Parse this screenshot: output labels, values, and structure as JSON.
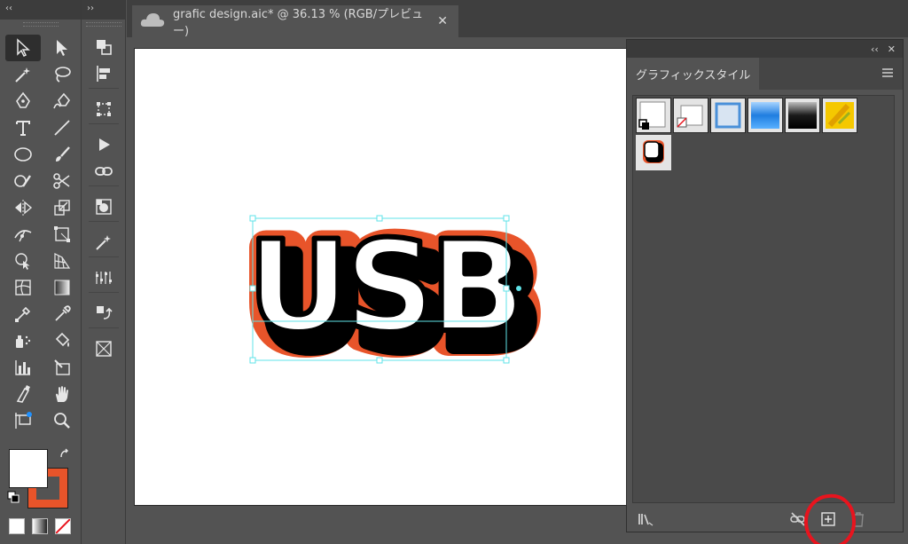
{
  "app": {
    "collapse_left": "‹‹",
    "collapse_dock": "››"
  },
  "document_tab": {
    "title": "grafic design.aic* @ 36.13 % (RGB/プレビュー)",
    "close": "✕"
  },
  "artboard": {
    "text": "USB",
    "fill_color": "#ffffff",
    "shadow_color": "#000000",
    "outline_color": "#e8542a",
    "selection_color": "#5fe3e8"
  },
  "colors": {
    "fill": "#ffffff",
    "stroke": "#e8542a"
  },
  "graphic_styles_panel": {
    "collapse": "‹‹",
    "close": "✕",
    "tab_label": "グラフィックスタイル",
    "styles": [
      "default",
      "none",
      "blue-frame",
      "blue-gradient",
      "black-gradient",
      "yellow-pattern",
      "usb-outline-style"
    ],
    "highlight_color": "#e8141e"
  }
}
